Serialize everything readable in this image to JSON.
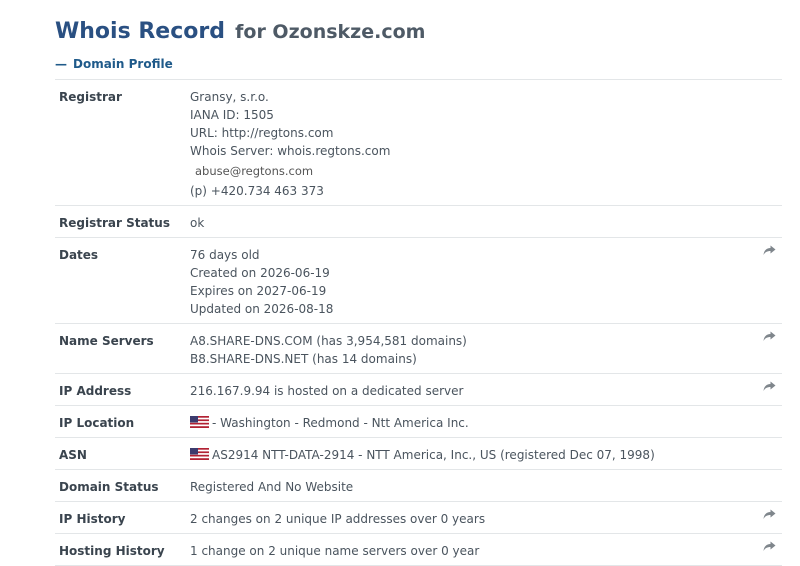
{
  "title": {
    "main": "Whois Record",
    "rest": "for Ozonskze.com"
  },
  "section": {
    "label": "Domain Profile"
  },
  "rows": [
    {
      "label": "Registrar",
      "lines": [
        "Gransy, s.r.o.",
        "IANA ID: 1505",
        "URL: http://regtons.com",
        "Whois Server: whois.regtons.com"
      ],
      "email": "abuse@regtons.com",
      "phone": "(p) +420.734 463 373"
    },
    {
      "label": "Registrar Status",
      "lines": [
        "ok"
      ]
    },
    {
      "label": "Dates",
      "lines": [
        "76 days old",
        "Created on 2026-06-19",
        "Expires on 2027-06-19",
        "Updated on 2026-08-18"
      ],
      "action_icon": "share-arrow-icon"
    },
    {
      "label": "Name Servers",
      "lines": [
        "A8.SHARE-DNS.COM (has 3,954,581 domains)",
        "B8.SHARE-DNS.NET (has 14 domains)"
      ],
      "action_icon": "share-arrow-icon"
    },
    {
      "label": "IP Address",
      "lines": [
        "216.167.9.94 is hosted on a dedicated server"
      ],
      "action_icon": "share-arrow-icon"
    },
    {
      "label": "IP Location",
      "lines": [
        "- Washington - Redmond - Ntt America Inc."
      ],
      "flag_icon": "us-flag-icon"
    },
    {
      "label": "ASN",
      "lines": [
        "AS2914 NTT-DATA-2914 - NTT America, Inc., US (registered Dec 07, 1998)"
      ],
      "flag_icon": "us-flag-icon"
    },
    {
      "label": "Domain Status",
      "lines": [
        "Registered And No Website"
      ]
    },
    {
      "label": "IP History",
      "lines": [
        "2 changes on 2 unique IP addresses over 0 years"
      ],
      "action_icon": "share-arrow-icon"
    },
    {
      "label": "Hosting History",
      "lines": [
        "1 change on 2 unique name servers over 0 year"
      ],
      "action_icon": "share-arrow-icon"
    }
  ],
  "colors": {
    "title": "#2a5082",
    "link": "#1f5a8a",
    "text": "#4a545e",
    "border": "#e3e6e8",
    "icon": "#7f868c"
  }
}
